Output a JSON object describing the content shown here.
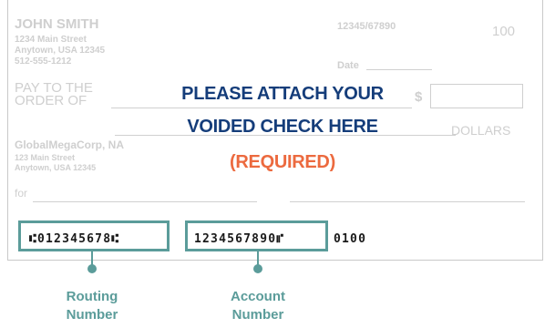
{
  "check": {
    "name": "JOHN SMITH",
    "address_line1": "1234 Main Street",
    "address_line2": "Anytown, USA 12345",
    "phone": "512-555-1212",
    "routing_fraction": "12345/67890",
    "check_number": "100",
    "date_label": "Date",
    "pay_to_line1": "PAY TO THE",
    "pay_to_line2": "ORDER OF",
    "dollar_sign": "$",
    "dollars_label": "DOLLARS",
    "bank_name": "GlobalMegaCorp, NA",
    "bank_address_line1": "123 Main Street",
    "bank_address_line2": "Anytown, USA 12345",
    "memo_label": "for"
  },
  "overlay": {
    "line1": "PLEASE ATTACH YOUR",
    "line2": "VOIDED CHECK HERE",
    "line3": "(REQUIRED)"
  },
  "micr": {
    "routing": "⑆012345678⑆",
    "account": "1234567890⑈",
    "check": "0100"
  },
  "labels": {
    "routing_line1": "Routing",
    "routing_line2": "Number",
    "account_line1": "Account",
    "account_line2": "Number"
  },
  "colors": {
    "overlay_primary": "#153d7a",
    "overlay_required": "#ec6a3f",
    "highlight": "#5b9c9a",
    "faint_text": "#cfcfcf"
  }
}
